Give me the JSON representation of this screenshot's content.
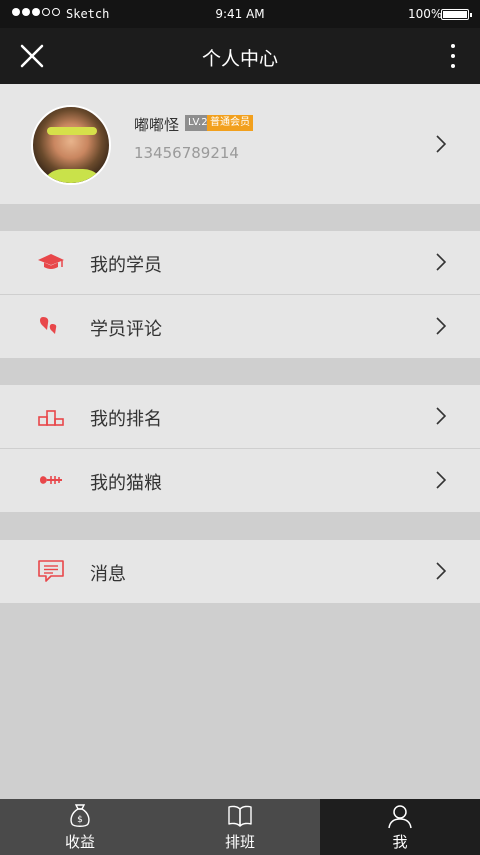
{
  "status_bar": {
    "carrier": "Sketch",
    "time": "9:41 AM",
    "battery": "100%"
  },
  "nav": {
    "title": "个人中心"
  },
  "profile": {
    "name": "嘟嘟怪",
    "level": "LV.2",
    "membership": "普通会员",
    "phone": "13456789214"
  },
  "menu": {
    "students": "我的学员",
    "reviews": "学员评论",
    "ranking": "我的排名",
    "cat_food": "我的猫粮",
    "messages": "消息"
  },
  "tabs": {
    "income": "收益",
    "schedule": "排班",
    "me": "我",
    "active": "我"
  },
  "colors": {
    "accent": "#e8474a",
    "badge_level": "#8e8e8e",
    "badge_member": "#f2a01d",
    "nav_bg": "#1c1c1c"
  }
}
